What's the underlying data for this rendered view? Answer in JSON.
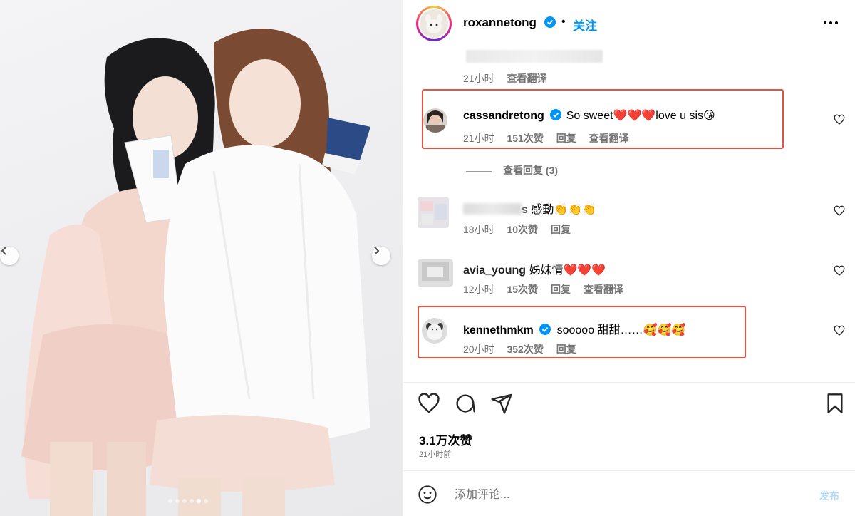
{
  "post": {
    "author": {
      "username": "roxannetong",
      "follow_label": "关注",
      "separator": "•"
    },
    "first_comment": {
      "time": "21小时",
      "translate": "查看翻译"
    },
    "comments": [
      {
        "username": "cassandretong",
        "verified": true,
        "text_before": "So sweet",
        "emojis_mid": "❤️❤️❤️",
        "text_after": "love u sis",
        "emoji_end": "😘",
        "time": "21小时",
        "likes": "151次赞",
        "reply": "回复",
        "translate": "查看翻译",
        "highlighted": true
      },
      {
        "username_visible": "s",
        "text": "感動",
        "emojis": "👏👏👏",
        "time": "18小时",
        "likes": "10次赞",
        "reply": "回复"
      },
      {
        "username_visible": "avia_young",
        "text": "姊妹情",
        "emojis": "❤️❤️❤️",
        "time": "12小时",
        "likes": "15次赞",
        "reply": "回复",
        "translate": "查看翻译"
      },
      {
        "username": "kennethmkm",
        "verified": true,
        "text": "sooooo 甜甜……",
        "emojis": "🥰🥰🥰",
        "time": "20小时",
        "likes": "352次赞",
        "reply": "回复",
        "highlighted": true
      }
    ],
    "view_replies": "查看回复 (3)",
    "likes_total": "3.1万次赞",
    "posted_ago": "21小时前",
    "add_comment_placeholder": "添加评论...",
    "post_label": "发布",
    "carousel": {
      "slides": 6,
      "active_index": 4
    }
  },
  "colors": {
    "accent_blue": "#0095f6",
    "secondary_text": "#737373",
    "highlight_box": "#e5533d"
  },
  "icons": [
    "verified-badge-icon",
    "more-options-icon",
    "heart-icon",
    "comment-icon",
    "share-icon",
    "bookmark-icon",
    "emoji-icon",
    "chevron-left-icon",
    "chevron-right-icon"
  ]
}
